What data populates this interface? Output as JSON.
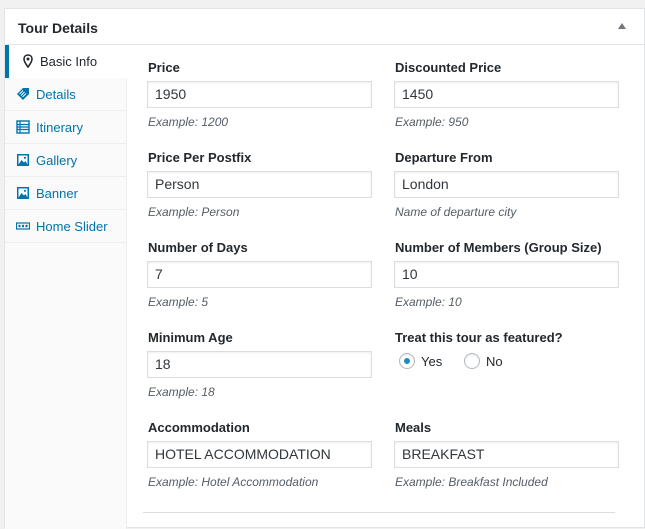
{
  "panel": {
    "title": "Tour Details"
  },
  "tabs": [
    {
      "label": "Basic Info",
      "icon": "map-pin-icon",
      "active": true
    },
    {
      "label": "Details",
      "icon": "tag-icon"
    },
    {
      "label": "Itinerary",
      "icon": "list-icon"
    },
    {
      "label": "Gallery",
      "icon": "image-icon"
    },
    {
      "label": "Banner",
      "icon": "image-icon"
    },
    {
      "label": "Home Slider",
      "icon": "slider-icon"
    }
  ],
  "fields": {
    "price": {
      "label": "Price",
      "value": "1950",
      "hint": "Example: 1200"
    },
    "discounted_price": {
      "label": "Discounted Price",
      "value": "1450",
      "hint": "Example: 950"
    },
    "price_postfix": {
      "label": "Price Per Postfix",
      "value": "Person",
      "hint": "Example: Person"
    },
    "departure": {
      "label": "Departure From",
      "value": "London",
      "hint": "Name of departure city"
    },
    "days": {
      "label": "Number of Days",
      "value": "7",
      "hint": "Example: 5"
    },
    "members": {
      "label": "Number of Members (Group Size)",
      "value": "10",
      "hint": "Example: 10"
    },
    "min_age": {
      "label": "Minimum Age",
      "value": "18",
      "hint": "Example: 18"
    },
    "featured": {
      "label": "Treat this tour as featured?",
      "yes": "Yes",
      "no": "No",
      "selected": "Yes"
    },
    "accommodation": {
      "label": "Accommodation",
      "value": "HOTEL ACCOMMODATION",
      "hint": "Example: Hotel Accommodation"
    },
    "meals": {
      "label": "Meals",
      "value": "BREAKFAST",
      "hint": "Example: Breakfast Included"
    }
  },
  "colors": {
    "accent": "#0073aa",
    "radio_checked": "#1e8cbe"
  }
}
